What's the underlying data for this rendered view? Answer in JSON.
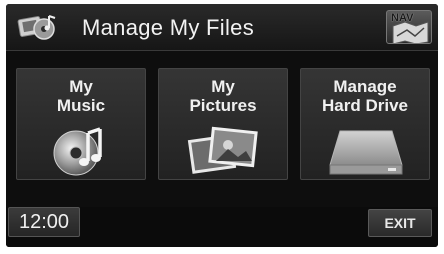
{
  "header": {
    "title": "Manage My Files",
    "title_icon": "media-files-icon",
    "nav_label": "NAV",
    "nav_icon": "map-icon"
  },
  "tiles": [
    {
      "line1": "My",
      "line2": "Music",
      "icon": "music-disc-icon"
    },
    {
      "line1": "My",
      "line2": "Pictures",
      "icon": "photos-icon"
    },
    {
      "line1": "Manage",
      "line2": "Hard Drive",
      "icon": "hard-drive-icon"
    }
  ],
  "footer": {
    "clock": "12:00",
    "exit_label": "EXIT"
  }
}
